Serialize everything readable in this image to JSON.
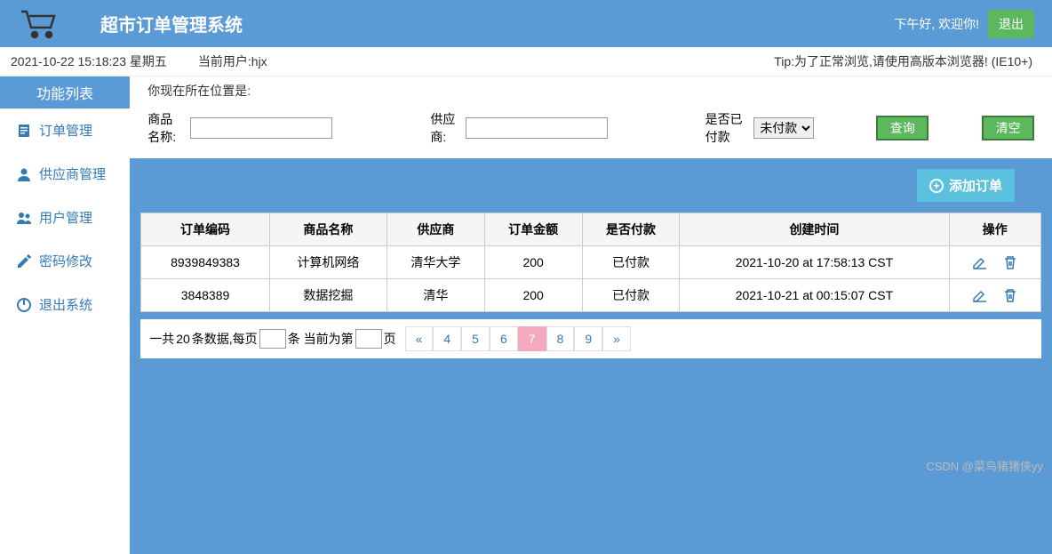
{
  "header": {
    "title": "超市订单管理系统",
    "welcome": "下午好, 欢迎你!",
    "logout": "退出"
  },
  "infobar": {
    "datetime": "2021-10-22 15:18:23 星期五",
    "current_user_label": "当前用户:",
    "current_user": "hjx",
    "tip": "Tip:为了正常浏览,请使用高版本浏览器!   (IE10+)"
  },
  "sidebar": {
    "header": "功能列表",
    "items": [
      {
        "label": "订单管理",
        "icon": "file-icon"
      },
      {
        "label": "供应商管理",
        "icon": "user-icon"
      },
      {
        "label": "用户管理",
        "icon": "users-icon"
      },
      {
        "label": "密码修改",
        "icon": "pencil-icon"
      },
      {
        "label": "退出系统",
        "icon": "power-icon"
      }
    ]
  },
  "breadcrumb": {
    "label": "你现在所在位置是:"
  },
  "search": {
    "name_label": "商品名称:",
    "name_value": "",
    "supplier_label": "供应商:",
    "supplier_value": "",
    "paid_label": "是否已付款",
    "paid_selected": "未付款",
    "query_btn": "查询",
    "reset_btn": "清空"
  },
  "add_button": "添加订单",
  "table": {
    "headers": [
      "订单编码",
      "商品名称",
      "供应商",
      "订单金额",
      "是否付款",
      "创建时间",
      "操作"
    ],
    "rows": [
      {
        "code": "8939849383",
        "name": "计算机网络",
        "supplier": "清华大学",
        "amount": "200",
        "paid": "已付款",
        "created": "2021-10-20 at 17:58:13 CST"
      },
      {
        "code": "3848389",
        "name": "数据挖掘",
        "supplier": "清华",
        "amount": "200",
        "paid": "已付款",
        "created": "2021-10-21 at 00:15:07 CST"
      }
    ]
  },
  "pagination": {
    "total": "20",
    "summary_p1": "一共",
    "summary_p2": "条数据,每页",
    "summary_p3": "条 当前为第",
    "summary_p4": "页",
    "per_page": "",
    "current_page": "",
    "pages": [
      "4",
      "5",
      "6",
      "7",
      "8",
      "9"
    ],
    "active": "7",
    "prev": "«",
    "next": "»"
  },
  "watermark": "CSDN @菜鸟猪猪侠yy"
}
